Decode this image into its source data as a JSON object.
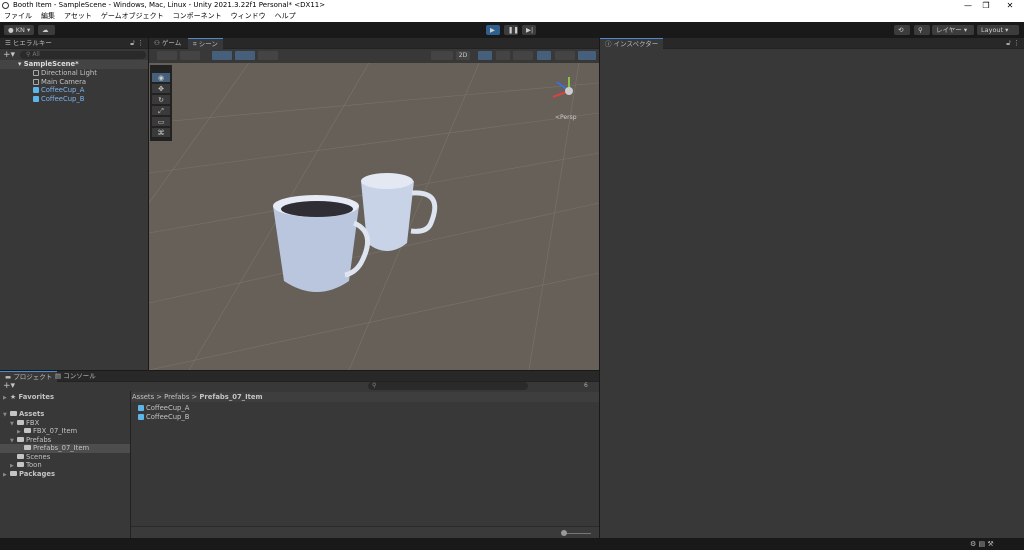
{
  "window": {
    "title": "Booth Item - SampleScene - Windows, Mac, Linux - Unity 2021.3.22f1 Personal* <DX11>",
    "minimize": "—",
    "maximize": "❐",
    "close": "✕"
  },
  "menu": [
    "ファイル",
    "編集",
    "アセット",
    "ゲームオブジェクト",
    "コンポーネント",
    "ウィンドウ",
    "ヘルプ"
  ],
  "toolbar": {
    "account": "KN ▾",
    "layers": "レイヤー",
    "layout": "Layout"
  },
  "hierarchy": {
    "tab": "ヒエラルキー",
    "search_placeholder": "All",
    "scene": "SampleScene*",
    "items": [
      {
        "label": "Directional Light"
      },
      {
        "label": "Main Camera"
      },
      {
        "label": "CoffeeCup_A"
      },
      {
        "label": "CoffeeCup_B"
      }
    ]
  },
  "scene_view": {
    "tabs": [
      "ゲーム",
      "シーン"
    ],
    "mode_2d": "2D",
    "persp": "<Persp"
  },
  "inspector": {
    "tab": "インスペクター"
  },
  "project": {
    "tabs": [
      "プロジェクト",
      "コンソール"
    ],
    "tree": {
      "favorites": "Favorites",
      "assets": "Assets",
      "fbx": "FBX",
      "fbx_item": "FBX_07_Item",
      "prefabs": "Prefabs",
      "prefabs_item": "Prefabs_07_Item",
      "scenes": "Scenes",
      "toon": "Toon",
      "packages": "Packages"
    },
    "breadcrumb": [
      "Assets",
      "Prefabs",
      "Prefabs_07_Item"
    ],
    "files": [
      "CoffeeCup_A",
      "CoffeeCup_B"
    ],
    "hidden_count": "6"
  }
}
